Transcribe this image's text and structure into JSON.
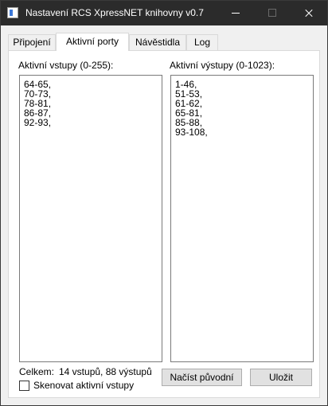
{
  "window": {
    "title": "Nastavení RCS XpressNET knihovny v0.7"
  },
  "tabs": [
    {
      "label": "Připojení"
    },
    {
      "label": "Aktivní porty"
    },
    {
      "label": "Návěstidla"
    },
    {
      "label": "Log"
    }
  ],
  "inputs": {
    "label": "Aktivní vstupy (0-255):",
    "lines": [
      "64-65,",
      "70-73,",
      "78-81,",
      "86-87,",
      "92-93,"
    ]
  },
  "outputs": {
    "label": "Aktivní výstupy (0-1023):",
    "lines": [
      "1-46,",
      "51-53,",
      "61-62,",
      "65-81,",
      "85-88,",
      "93-108,"
    ]
  },
  "summary": {
    "label": "Celkem:",
    "value": "14 vstupů, 88 výstupů"
  },
  "scan_checkbox": {
    "label": "Skenovat aktivní vstupy",
    "checked": false
  },
  "buttons": {
    "load_original": "Načíst původní",
    "save": "Uložit"
  }
}
